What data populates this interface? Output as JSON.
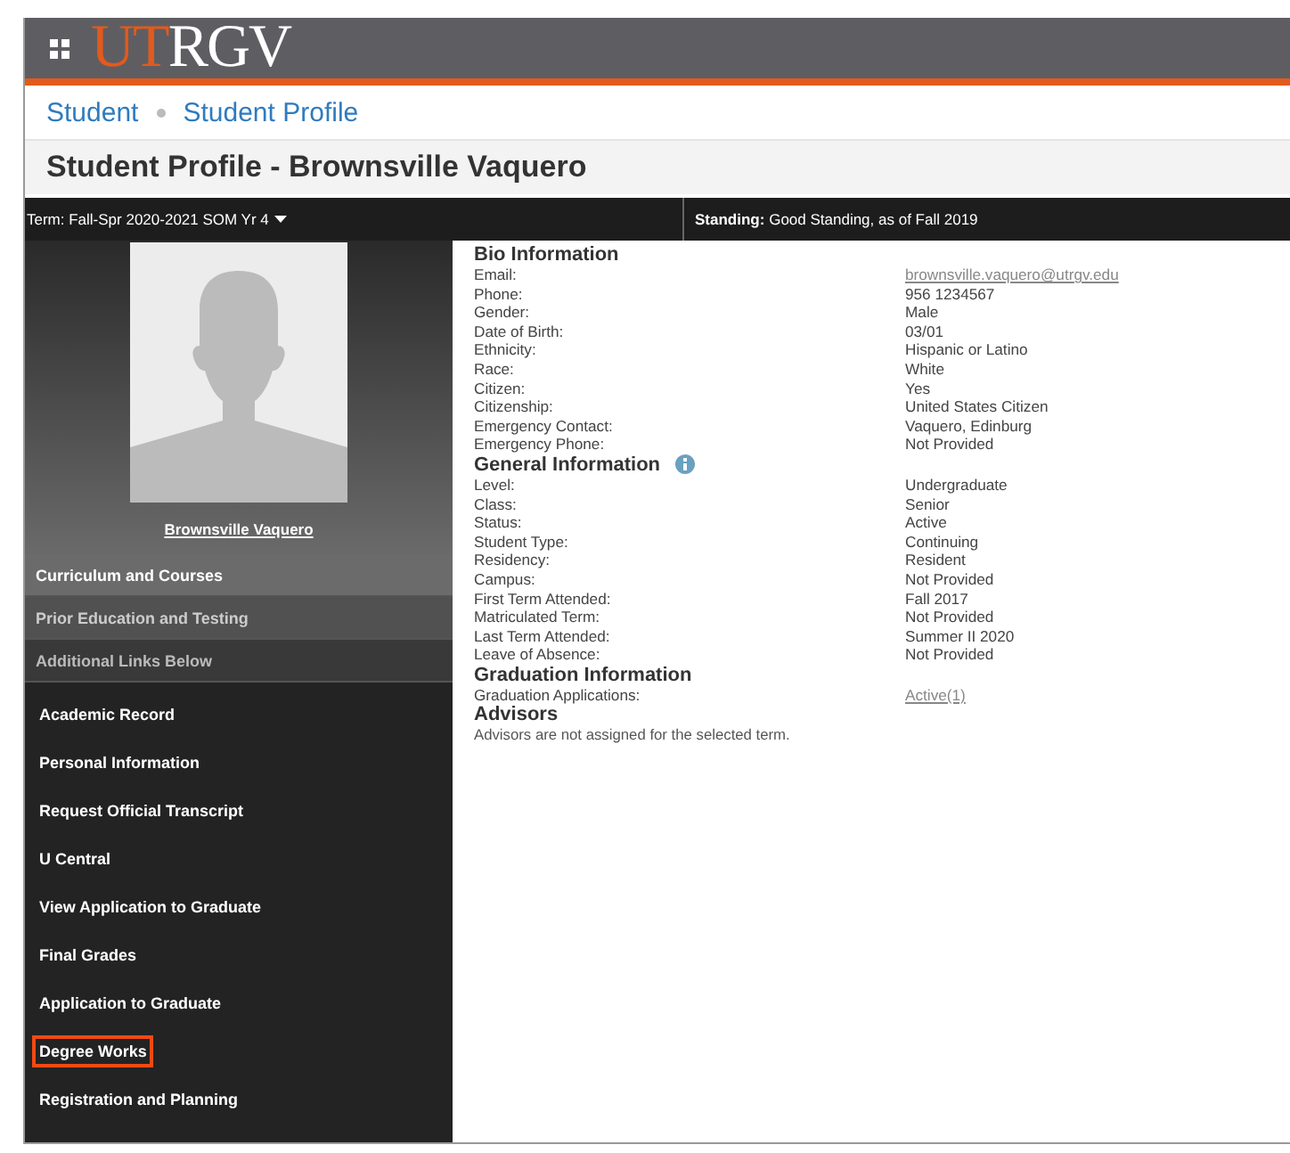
{
  "header": {
    "logo_first": "UT",
    "logo_second": "RGV"
  },
  "breadcrumb": [
    "Student",
    "Student Profile"
  ],
  "page_title": "Student Profile - Brownsville Vaquero",
  "term_bar": {
    "term": "Term: Fall-Spr 2020-2021 SOM Yr 4",
    "standing_label": "Standing:",
    "standing_value": "Good Standing, as of Fall 2019"
  },
  "profile": {
    "name": "Brownsville Vaquero"
  },
  "sidebar": {
    "sections": [
      {
        "label": "Curriculum and Courses",
        "kind": "primary"
      },
      {
        "label": "Prior Education and Testing",
        "kind": "secondary"
      },
      {
        "label": "Additional Links Below",
        "kind": "tertiary"
      }
    ],
    "links": [
      {
        "label": "Academic Record",
        "highlighted": false
      },
      {
        "label": "Personal Information",
        "highlighted": false
      },
      {
        "label": "Request Official Transcript",
        "highlighted": false
      },
      {
        "label": "U Central",
        "highlighted": false
      },
      {
        "label": "View Application to Graduate",
        "highlighted": false
      },
      {
        "label": "Final Grades",
        "highlighted": false
      },
      {
        "label": "Application to Graduate",
        "highlighted": false
      },
      {
        "label": "Degree Works",
        "highlighted": true
      },
      {
        "label": "Registration and Planning",
        "highlighted": false
      }
    ]
  },
  "sections": [
    {
      "title": "Bio Information",
      "info_icon": false,
      "rows": [
        {
          "label": "Email:",
          "value": "brownsville.vaquero@utrgv.edu",
          "kind": "link"
        },
        {
          "label": "Phone:",
          "value": "956 1234567",
          "kind": "text"
        },
        {
          "label": "Gender:",
          "value": "Male",
          "kind": "text"
        },
        {
          "label": "Date of Birth:",
          "value": "03/01",
          "kind": "text"
        },
        {
          "label": "Ethnicity:",
          "value": "Hispanic or Latino",
          "kind": "text"
        },
        {
          "label": "Race:",
          "value": "White",
          "kind": "text"
        },
        {
          "label": "Citizen:",
          "value": "Yes",
          "kind": "text"
        },
        {
          "label": "Citizenship:",
          "value": "United States Citizen",
          "kind": "text"
        },
        {
          "label": "Emergency Contact:",
          "value": "Vaquero, Edinburg",
          "kind": "text"
        },
        {
          "label": "Emergency Phone:",
          "value": "Not Provided",
          "kind": "text"
        }
      ]
    },
    {
      "title": "General Information",
      "info_icon": true,
      "rows": [
        {
          "label": "Level:",
          "value": "Undergraduate",
          "kind": "text"
        },
        {
          "label": "Class:",
          "value": "Senior",
          "kind": "text"
        },
        {
          "label": "Status:",
          "value": "Active",
          "kind": "text"
        },
        {
          "label": "Student Type:",
          "value": "Continuing",
          "kind": "text"
        },
        {
          "label": "Residency:",
          "value": "Resident",
          "kind": "text"
        },
        {
          "label": "Campus:",
          "value": "Not Provided",
          "kind": "text"
        },
        {
          "label": "First Term Attended:",
          "value": "Fall 2017",
          "kind": "text"
        },
        {
          "label": "Matriculated Term:",
          "value": "Not Provided",
          "kind": "text"
        },
        {
          "label": "Last Term Attended:",
          "value": "Summer II 2020",
          "kind": "text"
        },
        {
          "label": "Leave of Absence:",
          "value": "Not Provided",
          "kind": "text"
        }
      ]
    },
    {
      "title": "Graduation Information",
      "info_icon": false,
      "rows": [
        {
          "label": "Graduation Applications:",
          "value": "Active(1)",
          "kind": "link"
        }
      ]
    },
    {
      "title": "Advisors",
      "info_icon": false,
      "note": "Advisors are not assigned for the selected term."
    }
  ]
}
